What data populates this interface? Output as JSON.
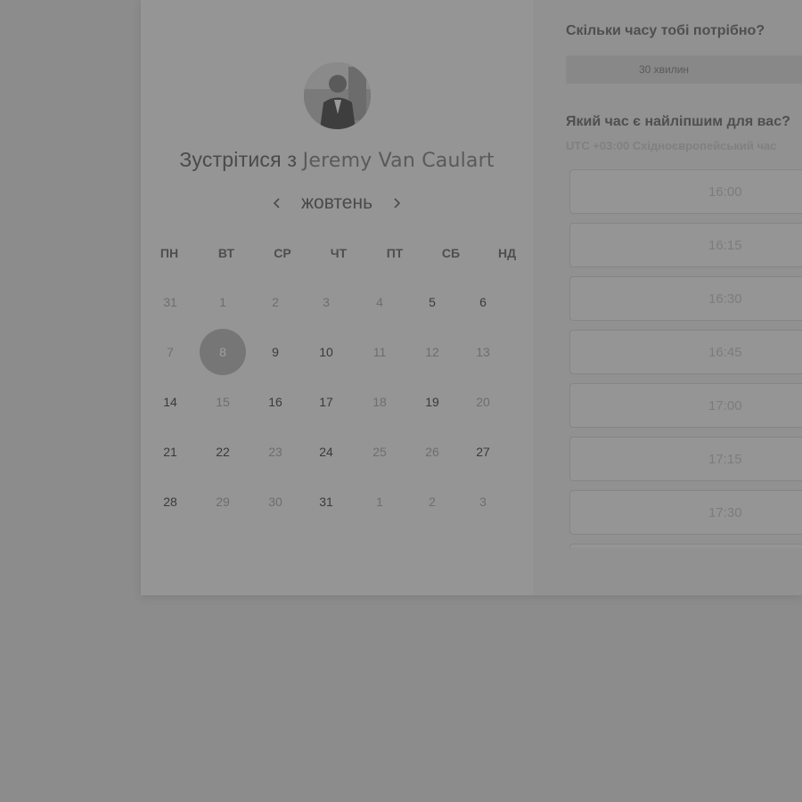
{
  "host": {
    "prefix": "Зустрітися з",
    "name": "Jeremy Van Caulart"
  },
  "calendar": {
    "month": "жовтень",
    "prev_icon": "chevron-left-icon",
    "next_icon": "chevron-right-icon",
    "weekdays": [
      "ПН",
      "ВТ",
      "СР",
      "ЧТ",
      "ПТ",
      "СБ",
      "НД"
    ],
    "weeks": [
      [
        {
          "d": "31",
          "s": "off"
        },
        {
          "d": "1",
          "s": "off"
        },
        {
          "d": "2",
          "s": "off"
        },
        {
          "d": "3",
          "s": "off"
        },
        {
          "d": "4",
          "s": "off"
        },
        {
          "d": "5",
          "s": "avail"
        },
        {
          "d": "6",
          "s": "avail"
        }
      ],
      [
        {
          "d": "7",
          "s": "off"
        },
        {
          "d": "8",
          "s": "selected"
        },
        {
          "d": "9",
          "s": "avail"
        },
        {
          "d": "10",
          "s": "avail"
        },
        {
          "d": "11",
          "s": "off"
        },
        {
          "d": "12",
          "s": "off"
        },
        {
          "d": "13",
          "s": "off"
        }
      ],
      [
        {
          "d": "14",
          "s": "avail"
        },
        {
          "d": "15",
          "s": "off"
        },
        {
          "d": "16",
          "s": "avail"
        },
        {
          "d": "17",
          "s": "avail"
        },
        {
          "d": "18",
          "s": "off"
        },
        {
          "d": "19",
          "s": "avail"
        },
        {
          "d": "20",
          "s": "off"
        }
      ],
      [
        {
          "d": "21",
          "s": "avail"
        },
        {
          "d": "22",
          "s": "avail"
        },
        {
          "d": "23",
          "s": "off"
        },
        {
          "d": "24",
          "s": "avail"
        },
        {
          "d": "25",
          "s": "off"
        },
        {
          "d": "26",
          "s": "off"
        },
        {
          "d": "27",
          "s": "avail"
        }
      ],
      [
        {
          "d": "28",
          "s": "avail"
        },
        {
          "d": "29",
          "s": "off"
        },
        {
          "d": "30",
          "s": "off"
        },
        {
          "d": "31",
          "s": "avail"
        },
        {
          "d": "1",
          "s": "off"
        },
        {
          "d": "2",
          "s": "off"
        },
        {
          "d": "3",
          "s": "off"
        }
      ]
    ]
  },
  "booking": {
    "duration_question": "Скільки часу тобі потрібно?",
    "duration_value": "30 хвилин",
    "time_question": "Який час є найліпшим для вас?",
    "timezone": "UTC +03:00 Східноєвропейський час",
    "slots": [
      "16:00",
      "16:15",
      "16:30",
      "16:45",
      "17:00",
      "17:15",
      "17:30",
      ""
    ]
  },
  "colors": {
    "overlay": "#8c8c8c",
    "selected_day": "#767676"
  }
}
